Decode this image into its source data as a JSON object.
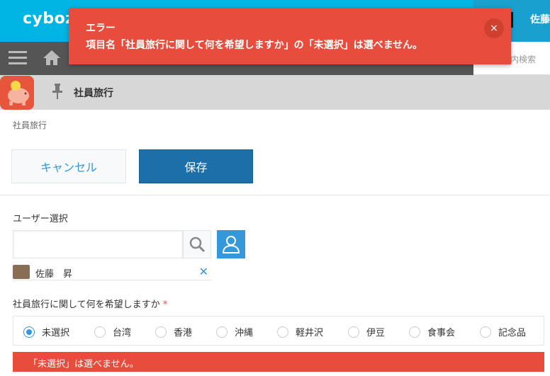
{
  "header": {
    "logo": "cyboz",
    "user_name": "佐藤",
    "search_placeholder": "内検索",
    "brand_color": "#00b4e4"
  },
  "toast": {
    "title": "エラー",
    "message": "項目名「社員旅行に関して何を希望しますか」の「未選択」は選べません。",
    "close_label": "×",
    "color": "#e74c3c"
  },
  "app": {
    "title": "社員旅行",
    "breadcrumb": "社員旅行"
  },
  "toolbar": {
    "cancel_label": "キャンセル",
    "save_label": "保存"
  },
  "form": {
    "user_field": {
      "label": "ユーザー選択",
      "value": "",
      "selected_user": "佐藤　昇",
      "remove_label": "✕"
    },
    "wish_field": {
      "label": "社員旅行に関して何を希望しますか",
      "required_mark": "*",
      "options": [
        "未選択",
        "台湾",
        "香港",
        "沖縄",
        "軽井沢",
        "伊豆",
        "食事会",
        "記念品"
      ],
      "selected": "未選択",
      "error": "「未選択」は選べません。"
    }
  }
}
